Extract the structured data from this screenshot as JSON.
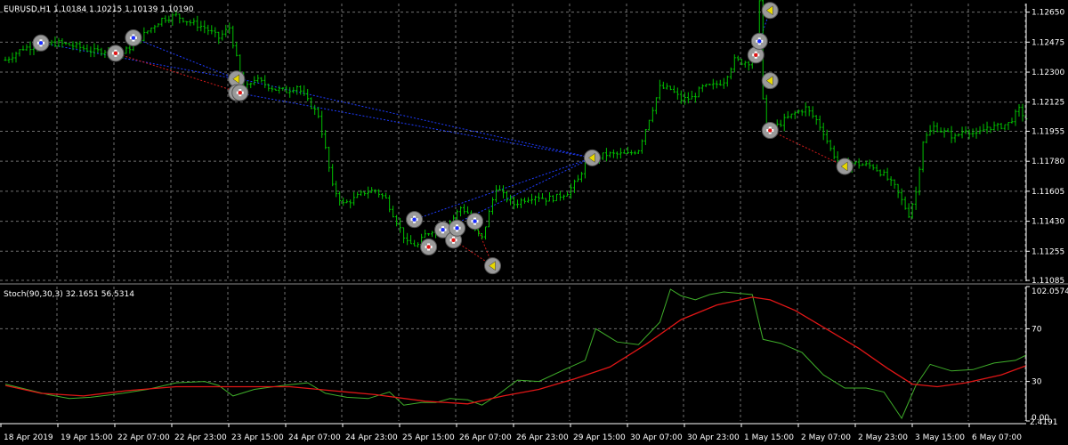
{
  "window": {
    "symbol_label": "EURUSD,H1  1.10184 1.10215 1.10139 1.10190"
  },
  "colors": {
    "background": "#000000",
    "grid": "#6f6f6f",
    "candle": "#00c000",
    "stoch_main": "#3fae2a",
    "stoch_signal": "#e01616",
    "trade_line_blue": "#1e3cff",
    "trade_line_red": "#d11a1a",
    "marker": "#9a9a9a"
  },
  "chart_data": [
    {
      "type": "candlestick",
      "title": "EURUSD,H1",
      "ohlc_text": "1.10184 1.10215 1.10139 1.10190",
      "ylim": [
        1.1108,
        1.127
      ],
      "y_ticks": [
        "1.12650",
        "1.12475",
        "1.12300",
        "1.12125",
        "1.11955",
        "1.11780",
        "1.11605",
        "1.11430",
        "1.11255",
        "1.11085"
      ],
      "y_tick_values": [
        1.1265,
        1.12475,
        1.123,
        1.12125,
        1.11955,
        1.1178,
        1.11605,
        1.1143,
        1.11255,
        1.11085
      ],
      "x_ticks": [
        "18 Apr 2019",
        "19 Apr 15:00",
        "22 Apr 07:00",
        "22 Apr 23:00",
        "23 Apr 15:00",
        "24 Apr 07:00",
        "24 Apr 23:00",
        "25 Apr 15:00",
        "26 Apr 07:00",
        "26 Apr 23:00",
        "29 Apr 15:00",
        "30 Apr 07:00",
        "30 Apr 23:00",
        "1 May 15:00",
        "2 May 07:00",
        "2 May 23:00",
        "3 May 15:00",
        "6 May 07:00"
      ],
      "close_path": [
        [
          0,
          1.1237
        ],
        [
          5,
          1.1244
        ],
        [
          10,
          1.1246
        ],
        [
          15,
          1.1247
        ],
        [
          20,
          1.1245
        ],
        [
          25,
          1.1242
        ],
        [
          30,
          1.1243
        ],
        [
          33,
          1.1241
        ],
        [
          36,
          1.1246
        ],
        [
          40,
          1.1254
        ],
        [
          44,
          1.1261
        ],
        [
          48,
          1.1263
        ],
        [
          52,
          1.1259
        ],
        [
          56,
          1.1256
        ],
        [
          60,
          1.125
        ],
        [
          63,
          1.1256
        ],
        [
          65,
          1.1238
        ],
        [
          67,
          1.1219
        ],
        [
          70,
          1.1226
        ],
        [
          73,
          1.1223
        ],
        [
          76,
          1.122
        ],
        [
          79,
          1.1219
        ],
        [
          82,
          1.1222
        ],
        [
          85,
          1.1213
        ],
        [
          88,
          1.1205
        ],
        [
          90,
          1.1185
        ],
        [
          92,
          1.1163
        ],
        [
          95,
          1.1153
        ],
        [
          98,
          1.1156
        ],
        [
          101,
          1.116
        ],
        [
          104,
          1.1161
        ],
        [
          107,
          1.1156
        ],
        [
          110,
          1.1143
        ],
        [
          113,
          1.113
        ],
        [
          116,
          1.1129
        ],
        [
          118,
          1.1135
        ],
        [
          120,
          1.1138
        ],
        [
          122,
          1.1139
        ],
        [
          124,
          1.1141
        ],
        [
          126,
          1.1145
        ],
        [
          128,
          1.1151
        ],
        [
          130,
          1.1148
        ],
        [
          132,
          1.1137
        ],
        [
          134,
          1.1133
        ],
        [
          136,
          1.1148
        ],
        [
          138,
          1.1163
        ],
        [
          140,
          1.1158
        ],
        [
          143,
          1.1153
        ],
        [
          146,
          1.1156
        ],
        [
          149,
          1.1158
        ],
        [
          152,
          1.1156
        ],
        [
          155,
          1.1157
        ],
        [
          158,
          1.116
        ],
        [
          161,
          1.1167
        ],
        [
          163,
          1.1177
        ],
        [
          166,
          1.118
        ],
        [
          169,
          1.1182
        ],
        [
          172,
          1.1182
        ],
        [
          175,
          1.1182
        ],
        [
          178,
          1.1185
        ],
        [
          181,
          1.1203
        ],
        [
          184,
          1.1221
        ],
        [
          187,
          1.122
        ],
        [
          190,
          1.1214
        ],
        [
          193,
          1.1215
        ],
        [
          196,
          1.1221
        ],
        [
          199,
          1.1222
        ],
        [
          202,
          1.1225
        ],
        [
          205,
          1.1237
        ],
        [
          207,
          1.1236
        ],
        [
          209,
          1.1236
        ],
        [
          211,
          1.124
        ],
        [
          212,
          1.127
        ],
        [
          213,
          1.1216
        ],
        [
          214,
          1.1195
        ],
        [
          216,
          1.1197
        ],
        [
          219,
          1.1202
        ],
        [
          222,
          1.1206
        ],
        [
          225,
          1.1209
        ],
        [
          228,
          1.1202
        ],
        [
          230,
          1.1195
        ],
        [
          232,
          1.1185
        ],
        [
          235,
          1.1175
        ],
        [
          238,
          1.1177
        ],
        [
          241,
          1.1176
        ],
        [
          244,
          1.1175
        ],
        [
          247,
          1.117
        ],
        [
          250,
          1.1163
        ],
        [
          252,
          1.1155
        ],
        [
          254,
          1.1147
        ],
        [
          256,
          1.116
        ],
        [
          258,
          1.119
        ],
        [
          261,
          1.1198
        ],
        [
          264,
          1.1195
        ],
        [
          267,
          1.1192
        ],
        [
          270,
          1.1197
        ],
        [
          273,
          1.1193
        ],
        [
          276,
          1.1198
        ],
        [
          279,
          1.1198
        ],
        [
          282,
          1.12
        ],
        [
          285,
          1.1208
        ],
        [
          287,
          1.1203
        ]
      ],
      "bar_count": 288
    },
    {
      "type": "line",
      "title": "Stoch(90,30,3) 32.1651 56.5314",
      "ylim": [
        0,
        102.0574
      ],
      "y_ticks": [
        "102.0574",
        "70",
        "30",
        "0.00"
      ],
      "y_tick_values": [
        102.0574,
        70,
        30,
        0
      ],
      "extra_label": "2.4191",
      "series": [
        {
          "name": "main",
          "points": [
            [
              0,
              28
            ],
            [
              12,
              20
            ],
            [
              18,
              17
            ],
            [
              24,
              18
            ],
            [
              33,
              21
            ],
            [
              40,
              24
            ],
            [
              48,
              29
            ],
            [
              56,
              30
            ],
            [
              60,
              27
            ],
            [
              64,
              19
            ],
            [
              70,
              24
            ],
            [
              78,
              27
            ],
            [
              85,
              29
            ],
            [
              90,
              21
            ],
            [
              96,
              18
            ],
            [
              102,
              17
            ],
            [
              108,
              22
            ],
            [
              112,
              12
            ],
            [
              117,
              14
            ],
            [
              121,
              14
            ],
            [
              125,
              17
            ],
            [
              130,
              16
            ],
            [
              134,
              12
            ],
            [
              138,
              19
            ],
            [
              144,
              31
            ],
            [
              150,
              30
            ],
            [
              158,
              40
            ],
            [
              163,
              46
            ],
            [
              166,
              70
            ],
            [
              172,
              60
            ],
            [
              178,
              58
            ],
            [
              184,
              75
            ],
            [
              187,
              100
            ],
            [
              190,
              95
            ],
            [
              194,
              92
            ],
            [
              198,
              96
            ],
            [
              202,
              98
            ],
            [
              206,
              97
            ],
            [
              210,
              96
            ],
            [
              213,
              62
            ],
            [
              218,
              59
            ],
            [
              224,
              52
            ],
            [
              230,
              35
            ],
            [
              236,
              25
            ],
            [
              242,
              25
            ],
            [
              247,
              22
            ],
            [
              252,
              2
            ],
            [
              256,
              27
            ],
            [
              260,
              43
            ],
            [
              266,
              38
            ],
            [
              272,
              39
            ],
            [
              278,
              44
            ],
            [
              284,
              46
            ],
            [
              287,
              50
            ]
          ]
        },
        {
          "name": "signal",
          "points": [
            [
              0,
              27
            ],
            [
              10,
              21
            ],
            [
              22,
              19
            ],
            [
              34,
              23
            ],
            [
              48,
              26
            ],
            [
              62,
              26
            ],
            [
              80,
              26
            ],
            [
              92,
              23
            ],
            [
              104,
              20
            ],
            [
              118,
              15
            ],
            [
              130,
              13
            ],
            [
              140,
              19
            ],
            [
              150,
              24
            ],
            [
              160,
              32
            ],
            [
              170,
              41
            ],
            [
              180,
              58
            ],
            [
              190,
              77
            ],
            [
              200,
              88
            ],
            [
              210,
              94
            ],
            [
              215,
              92
            ],
            [
              222,
              84
            ],
            [
              232,
              68
            ],
            [
              240,
              55
            ],
            [
              248,
              40
            ],
            [
              255,
              28
            ],
            [
              262,
              26
            ],
            [
              270,
              29
            ],
            [
              280,
              35
            ],
            [
              287,
              42
            ]
          ]
        }
      ]
    }
  ],
  "trade_markers": [
    {
      "i": 10,
      "p": 1.1247,
      "kind": "buy"
    },
    {
      "i": 31,
      "p": 1.1241,
      "kind": "sell"
    },
    {
      "i": 36,
      "p": 1.125,
      "kind": "buy"
    },
    {
      "i": 65,
      "p": 1.1226,
      "kind": "close"
    },
    {
      "i": 65,
      "p": 1.1218,
      "kind": "sell"
    },
    {
      "i": 66,
      "p": 1.1218,
      "kind": "sell"
    },
    {
      "i": 115,
      "p": 1.1144,
      "kind": "buy"
    },
    {
      "i": 119,
      "p": 1.1128,
      "kind": "sell"
    },
    {
      "i": 123,
      "p": 1.1138,
      "kind": "buy"
    },
    {
      "i": 126,
      "p": 1.1132,
      "kind": "sell"
    },
    {
      "i": 127,
      "p": 1.1139,
      "kind": "buy"
    },
    {
      "i": 132,
      "p": 1.1143,
      "kind": "buy"
    },
    {
      "i": 137,
      "p": 1.1117,
      "kind": "close"
    },
    {
      "i": 165,
      "p": 1.118,
      "kind": "close"
    },
    {
      "i": 211,
      "p": 1.124,
      "kind": "sell"
    },
    {
      "i": 212,
      "p": 1.1248,
      "kind": "buy"
    },
    {
      "i": 215,
      "p": 1.1266,
      "kind": "close"
    },
    {
      "i": 215,
      "p": 1.1225,
      "kind": "close"
    },
    {
      "i": 215,
      "p": 1.1196,
      "kind": "sell"
    },
    {
      "i": 236,
      "p": 1.1175,
      "kind": "close"
    }
  ],
  "trade_lines": [
    {
      "from": [
        10,
        1.1247
      ],
      "to": [
        65,
        1.1226
      ],
      "color": "blue"
    },
    {
      "from": [
        31,
        1.1241
      ],
      "to": [
        66,
        1.1218
      ],
      "color": "red"
    },
    {
      "from": [
        36,
        1.125
      ],
      "to": [
        65,
        1.1226
      ],
      "color": "blue"
    },
    {
      "from": [
        66,
        1.1226
      ],
      "to": [
        165,
        1.118
      ],
      "color": "blue"
    },
    {
      "from": [
        65,
        1.1218
      ],
      "to": [
        165,
        1.118
      ],
      "color": "blue"
    },
    {
      "from": [
        115,
        1.1144
      ],
      "to": [
        165,
        1.118
      ],
      "color": "blue"
    },
    {
      "from": [
        123,
        1.1138
      ],
      "to": [
        165,
        1.118
      ],
      "color": "blue"
    },
    {
      "from": [
        132,
        1.1143
      ],
      "to": [
        137,
        1.1117
      ],
      "color": "red"
    },
    {
      "from": [
        126,
        1.1132
      ],
      "to": [
        137,
        1.1117
      ],
      "color": "red"
    },
    {
      "from": [
        212,
        1.1248
      ],
      "to": [
        215,
        1.1266
      ],
      "color": "blue"
    },
    {
      "from": [
        215,
        1.1196
      ],
      "to": [
        236,
        1.1175
      ],
      "color": "red"
    }
  ]
}
